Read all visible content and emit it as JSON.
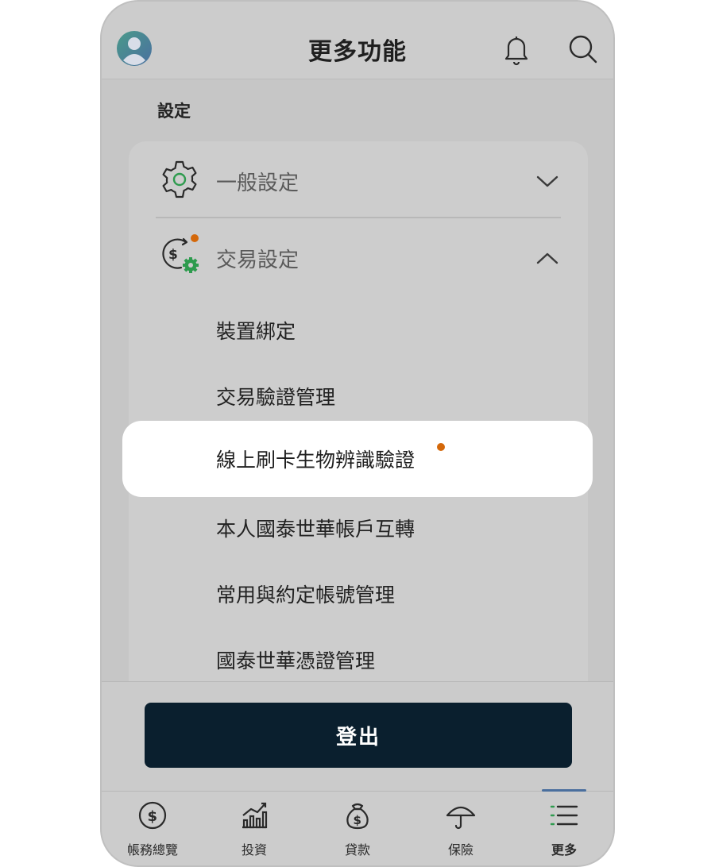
{
  "header": {
    "title": "更多功能"
  },
  "settings": {
    "section_title": "設定",
    "general": {
      "label": "一般設定",
      "expanded": false
    },
    "transaction": {
      "label": "交易設定",
      "expanded": true,
      "has_notification": true,
      "items": [
        {
          "label": "裝置綁定"
        },
        {
          "label": "交易驗證管理"
        },
        {
          "label": "線上刷卡生物辨識驗證",
          "highlighted": true,
          "has_notification": true
        },
        {
          "label": "本人國泰世華帳戶互轉"
        },
        {
          "label": "常用與約定帳號管理"
        },
        {
          "label": "國泰世華憑證管理"
        }
      ]
    }
  },
  "logout": {
    "label": "登出"
  },
  "bottom_nav": {
    "items": [
      {
        "label": "帳務總覽",
        "icon": "dollar-coin-icon"
      },
      {
        "label": "投資",
        "icon": "bar-chart-icon"
      },
      {
        "label": "貸款",
        "icon": "money-bag-icon"
      },
      {
        "label": "保險",
        "icon": "umbrella-icon"
      },
      {
        "label": "更多",
        "icon": "menu-list-icon",
        "active": true
      }
    ]
  },
  "colors": {
    "accent_green": "#2e9b4e",
    "notification_orange": "#d4680a",
    "logout_bg": "#0a1f2e",
    "active_nav_indicator": "#4a6f9e"
  }
}
